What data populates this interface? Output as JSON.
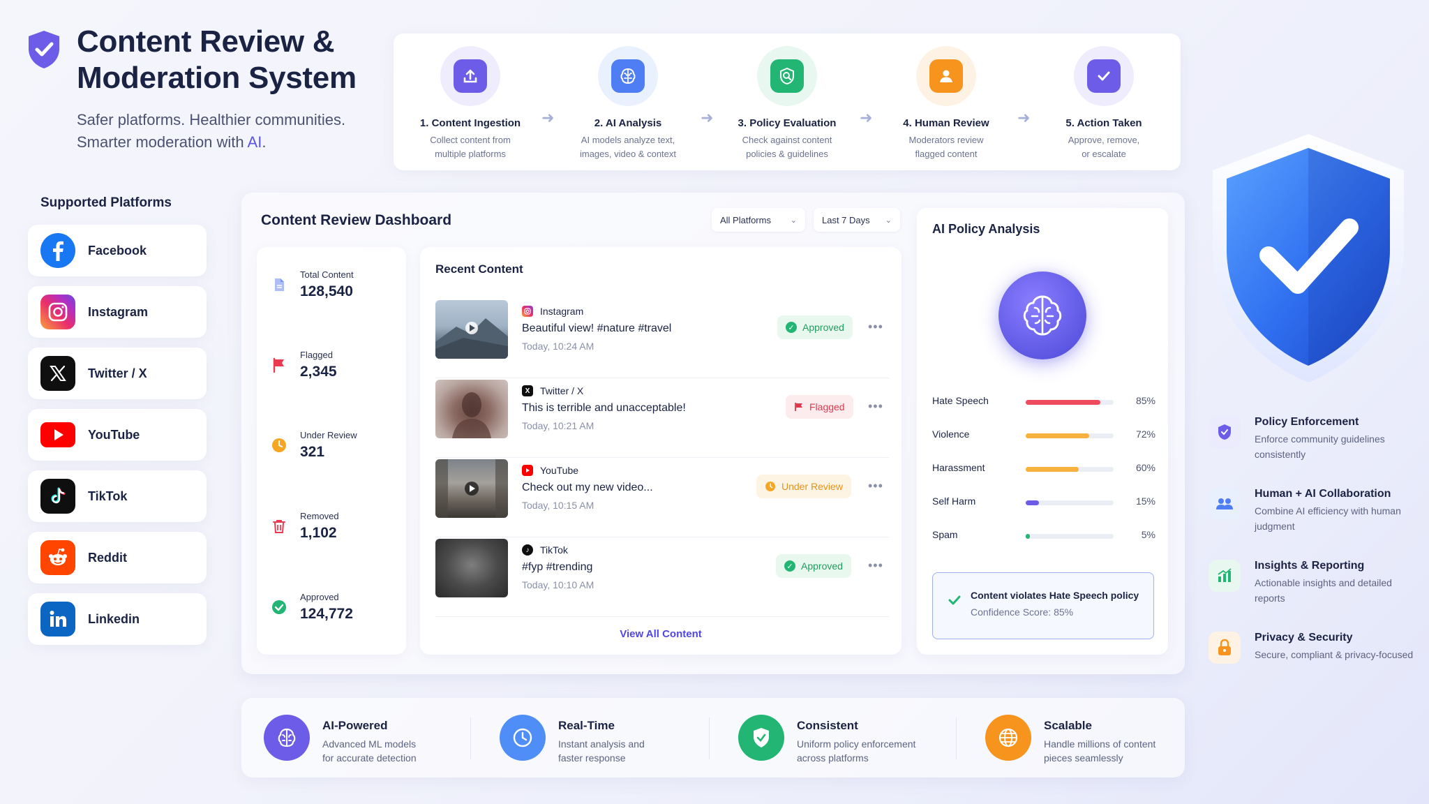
{
  "header": {
    "title_line1": "Content Review &",
    "title_line2": "Moderation System",
    "subtitle_line1": "Safer platforms. Healthier communities.",
    "subtitle_line2_prefix": "Smarter moderation with ",
    "subtitle_line2_ai": "AI",
    "subtitle_line2_suffix": "."
  },
  "pipeline": [
    {
      "title": "1. Content Ingestion",
      "desc1": "Collect content from",
      "desc2": "multiple platforms",
      "icon": "upload-icon",
      "color": "#6c5ce7"
    },
    {
      "title": "2. AI Analysis",
      "desc1": "AI models analyze text,",
      "desc2": "images, video & context",
      "icon": "brain-icon",
      "color": "#4f7df3"
    },
    {
      "title": "3. Policy Evaluation",
      "desc1": "Check against content",
      "desc2": "policies & guidelines",
      "icon": "policy-search-icon",
      "color": "#22b573"
    },
    {
      "title": "4. Human Review",
      "desc1": "Moderators review",
      "desc2": "flagged content",
      "icon": "user-icon",
      "color": "#f7941d"
    },
    {
      "title": "5. Action Taken",
      "desc1": "Approve, remove,",
      "desc2": "or escalate",
      "icon": "check-icon",
      "color": "#6c5ce7"
    }
  ],
  "platforms": {
    "title": "Supported Platforms",
    "items": [
      "Facebook",
      "Instagram",
      "Twitter / X",
      "YouTube",
      "TikTok",
      "Reddit",
      "Linkedin"
    ]
  },
  "dashboard": {
    "title": "Content Review Dashboard",
    "filter_platform": "All Platforms",
    "filter_range": "Last 7 Days",
    "stats": [
      {
        "label": "Total Content",
        "value": "128,540"
      },
      {
        "label": "Flagged",
        "value": "2,345"
      },
      {
        "label": "Under Review",
        "value": "321"
      },
      {
        "label": "Removed",
        "value": "1,102"
      },
      {
        "label": "Approved",
        "value": "124,772"
      }
    ],
    "recent": {
      "title": "Recent Content",
      "rows": [
        {
          "platform": "Instagram",
          "text": "Beautiful view! #nature #travel",
          "time": "Today, 10:24 AM",
          "status": "Approved"
        },
        {
          "platform": "Twitter / X",
          "text": "This is terrible and unacceptable!",
          "time": "Today, 10:21 AM",
          "status": "Flagged"
        },
        {
          "platform": "YouTube",
          "text": "Check out my new video...",
          "time": "Today, 10:15 AM",
          "status": "Under Review"
        },
        {
          "platform": "TikTok",
          "text": "#fyp #trending",
          "time": "Today, 10:10 AM",
          "status": "Approved"
        }
      ],
      "more": "•••",
      "view_all": "View All Content"
    }
  },
  "ai_policy": {
    "title": "AI Policy Analysis",
    "scores": [
      {
        "label": "Hate Speech",
        "value": 85,
        "pct": "85%",
        "color": "#ef4b5f"
      },
      {
        "label": "Violence",
        "value": 72,
        "pct": "72%",
        "color": "#f6b23c"
      },
      {
        "label": "Harassment",
        "value": 60,
        "pct": "60%",
        "color": "#f6b23c"
      },
      {
        "label": "Self Harm",
        "value": 15,
        "pct": "15%",
        "color": "#6c5ce7"
      },
      {
        "label": "Spam",
        "value": 5,
        "pct": "5%",
        "color": "#22b573"
      }
    ],
    "verdict": "Content violates Hate Speech policy",
    "confidence": "Confidence Score: 85%"
  },
  "features": [
    {
      "title": "Policy Enforcement",
      "desc": "Enforce community guidelines consistently",
      "icon": "shield-icon"
    },
    {
      "title": "Human + AI Collaboration",
      "desc": "Combine AI efficiency with human judgment",
      "icon": "users-icon"
    },
    {
      "title": "Insights & Reporting",
      "desc": "Actionable insights and detailed reports",
      "icon": "chart-icon"
    },
    {
      "title": "Privacy & Security",
      "desc": "Secure, compliant & privacy-focused",
      "icon": "lock-icon"
    }
  ],
  "bottom": [
    {
      "title": "AI-Powered",
      "desc1": "Advanced ML models",
      "desc2": "for accurate detection",
      "color": "#6c5ce7"
    },
    {
      "title": "Real-Time",
      "desc1": "Instant analysis and",
      "desc2": "faster response",
      "color": "#4f8ef7"
    },
    {
      "title": "Consistent",
      "desc1": "Uniform policy enforcement",
      "desc2": "across platforms",
      "color": "#22b573"
    },
    {
      "title": "Scalable",
      "desc1": "Handle millions of content",
      "desc2": "pieces seamlessly",
      "color": "#f7941d"
    }
  ]
}
